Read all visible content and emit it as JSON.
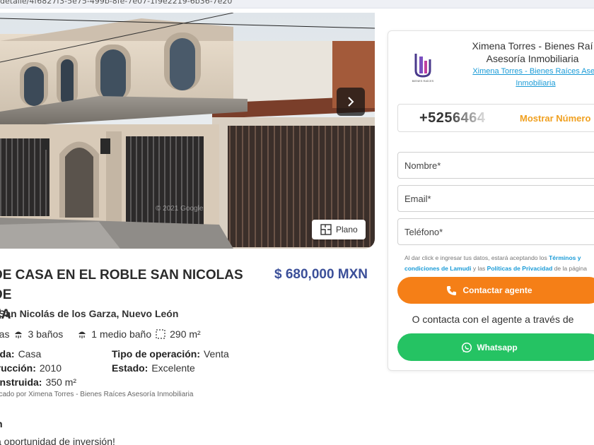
{
  "browser": {
    "url_fragment": "detalle/4f6827f3-5e75-499b-8fe-7e07-1f9e2219-6b36-7e20"
  },
  "gallery": {
    "plano_label": "Plano",
    "watermark": "© 2021 Google"
  },
  "listing": {
    "title": "DE CASA EN EL ROBLE SAN NICOLAS DE ZA",
    "title_line1": "DE CASA EN EL ROBLE SAN NICOLAS DE",
    "title_line2": "ZA",
    "price": "$ 680,000 MXN",
    "location": "San Nicolás de los Garza, Nuevo León",
    "features": {
      "rooms_fragment": "ras",
      "bathrooms": "3 baños",
      "half_bath": "1 medio baño",
      "area": "290 m²"
    },
    "details": {
      "left": [
        {
          "label": "nda:",
          "value": "Casa"
        },
        {
          "label": "trucción:",
          "value": "2010"
        },
        {
          "label": "onstruida:",
          "value": "350 m²"
        }
      ],
      "right": [
        {
          "label": "Tipo de operación:",
          "value": "Venta"
        },
        {
          "label": "Estado:",
          "value": "Excelente"
        }
      ]
    },
    "published_by": "licado por Ximena Torres - Bienes Raíces Asesoría Inmobiliaria",
    "description_heading": "n",
    "description_line": "a oportunidad de inversión!"
  },
  "agent": {
    "name_line1": "Ximena Torres - Bienes Raí",
    "name_line2": "Asesoría Inmobiliaria",
    "link_line1": "Ximena Torres - Bienes Raíces Ases",
    "link_line2": "Inmobiliaria",
    "phone": "+5256464",
    "show_number": "Mostrar Número"
  },
  "form": {
    "name_placeholder": "Nombre*",
    "email_placeholder": "Email*",
    "phone_placeholder": "Teléfono*",
    "legal_pre": "Al dar click e ingresar tus datos, estará aceptando los ",
    "legal_terms": "Términos y condiciones de Lamudi",
    "legal_mid": " y las ",
    "legal_privacy": "Políticas de Privacidad",
    "legal_post": " de la página",
    "contact_label": "Contactar agente",
    "or_text": "O contacta con el agente a través de",
    "whatsapp_label": "Whatsapp"
  },
  "colors": {
    "price": "#3b4f99",
    "contact_button": "#f57f17",
    "whatsapp_button": "#25c363",
    "link": "#1a9bd7",
    "show_number": "#f0a020"
  }
}
